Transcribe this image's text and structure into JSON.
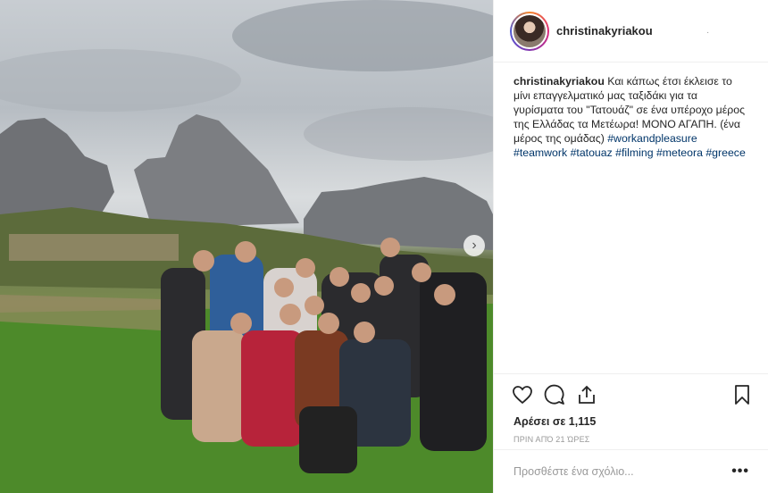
{
  "post": {
    "username": "christinakyriakou",
    "header_dot": ".",
    "caption": {
      "user": "christinakyriakou",
      "text": "Και κάπως έτσι έκλεισε το μίνι επαγγελματικό μας ταξιδάκι για τα γυρίσματα του \"Τατουάζ\" σε ένα υπέροχο μέρος της Ελλάδας τα Μετέωρα! ΜΟΝΟ ΑΓΑΠΗ. (ένα μέρος της ομάδας)",
      "hashtags": [
        "#workandpleasure",
        "#teamwork",
        "#tatouaz",
        "#filming",
        "#meteora",
        "#greece"
      ]
    },
    "likes": "Αρέσει σε 1,115",
    "time": "ΠΡΙΝ ΑΠΌ 21 ΏΡΕΣ",
    "comment_placeholder": "Προσθέστε ένα σχόλιο...",
    "comment_more": "•••",
    "next_arrow": "›"
  },
  "icons": {
    "like": "heart-icon",
    "comment": "comment-icon",
    "share": "share-icon",
    "save": "bookmark-icon",
    "next": "chevron-right-icon"
  }
}
